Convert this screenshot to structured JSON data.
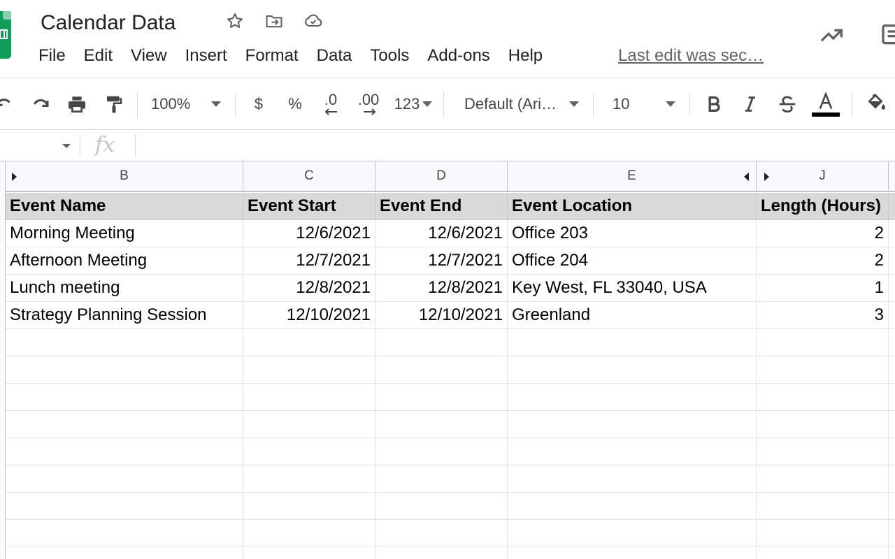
{
  "title": "Calendar Data",
  "menu": [
    "File",
    "Edit",
    "View",
    "Insert",
    "Format",
    "Data",
    "Tools",
    "Add-ons",
    "Help"
  ],
  "last_edit": "Last edit was sec…",
  "toolbar": {
    "zoom": "100%",
    "currency": "$",
    "percent": "%",
    "decrease_decimal": ".0",
    "increase_decimal": ".00",
    "more_formats": "123",
    "font": "Default (Ari…",
    "font_size": "10",
    "text_color": "#000000"
  },
  "formula": {
    "fx": "fx",
    "value": ""
  },
  "columns": [
    "B",
    "C",
    "D",
    "E",
    "J"
  ],
  "header_row": [
    "Event Name",
    "Event Start",
    "Event End",
    "Event Location",
    "Length (Hours)"
  ],
  "rows": [
    [
      "Morning Meeting",
      "12/6/2021",
      "12/6/2021",
      "Office 203",
      "2"
    ],
    [
      "Afternoon Meeting",
      "12/7/2021",
      "12/7/2021",
      "Office 204",
      "2"
    ],
    [
      "Lunch meeting",
      "12/8/2021",
      "12/8/2021",
      "Key West, FL 33040, USA",
      "1"
    ],
    [
      "Strategy Planning Session",
      "12/10/2021",
      "12/10/2021",
      "Greenland",
      "3"
    ]
  ]
}
